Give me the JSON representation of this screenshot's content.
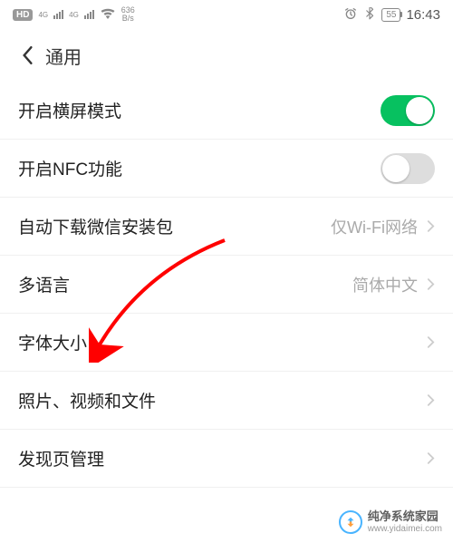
{
  "status": {
    "hd_badge": "HD",
    "net_type": "4G",
    "speed_value": "636",
    "speed_unit": "B/s",
    "battery_pct": "55",
    "time": "16:43"
  },
  "header": {
    "title": "通用"
  },
  "rows": {
    "landscape": {
      "label": "开启横屏模式"
    },
    "nfc": {
      "label": "开启NFC功能"
    },
    "download": {
      "label": "自动下载微信安装包",
      "value": "仅Wi-Fi网络"
    },
    "language": {
      "label": "多语言",
      "value": "简体中文"
    },
    "fontsize": {
      "label": "字体大小"
    },
    "media": {
      "label": "照片、视频和文件"
    },
    "discover": {
      "label": "发现页管理"
    }
  },
  "watermark": {
    "name": "纯净系统家园",
    "url": "www.yidaimei.com"
  }
}
